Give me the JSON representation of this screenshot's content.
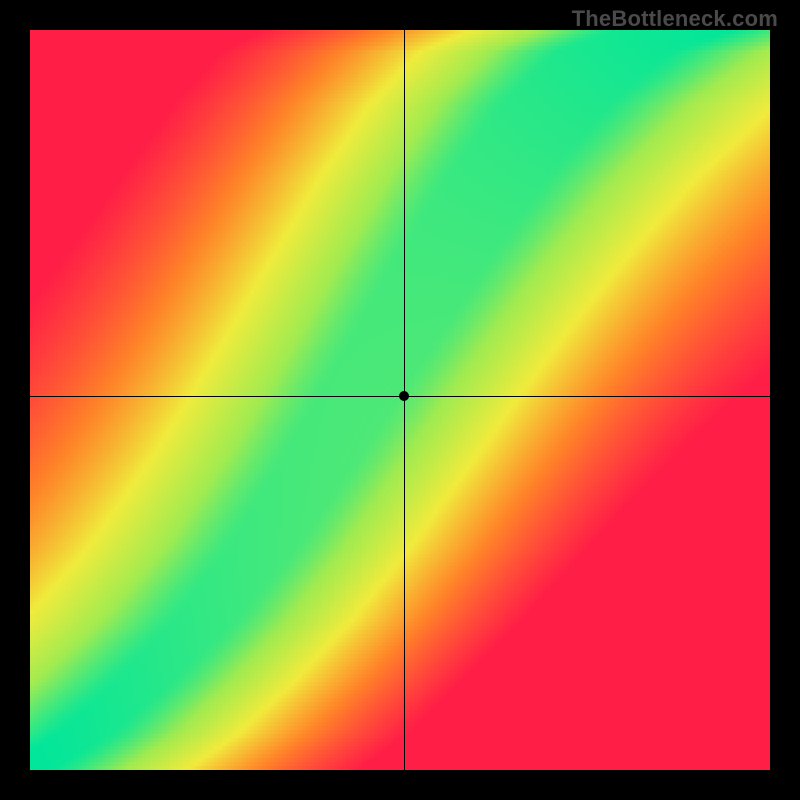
{
  "watermark": "TheBottleneck.com",
  "chart_data": {
    "type": "heatmap",
    "title": "",
    "xlabel": "",
    "ylabel": "",
    "xlim": [
      0,
      1
    ],
    "ylim": [
      0,
      1
    ],
    "grid": false,
    "crosshair": {
      "x": 0.505,
      "y": 0.505
    },
    "marker": {
      "x": 0.505,
      "y": 0.505
    },
    "colorscale_note": "0=red, 0.5=yellow, 1=green; value represents proximity to optimal diagonal band",
    "band": {
      "description": "Optimal (green) band is a steep diagonal curve; away from it value decays through yellow/orange to red",
      "points_norm": [
        [
          0.0,
          0.0
        ],
        [
          0.08,
          0.05
        ],
        [
          0.16,
          0.12
        ],
        [
          0.24,
          0.2
        ],
        [
          0.32,
          0.3
        ],
        [
          0.4,
          0.42
        ],
        [
          0.48,
          0.55
        ],
        [
          0.56,
          0.68
        ],
        [
          0.64,
          0.8
        ],
        [
          0.72,
          0.9
        ],
        [
          0.8,
          0.97
        ],
        [
          0.88,
          1.0
        ]
      ],
      "half_width_norm_base": 0.035,
      "half_width_norm_growth": 0.05
    },
    "corner_bias": {
      "top_left": -0.25,
      "bottom_right": -0.45
    }
  }
}
